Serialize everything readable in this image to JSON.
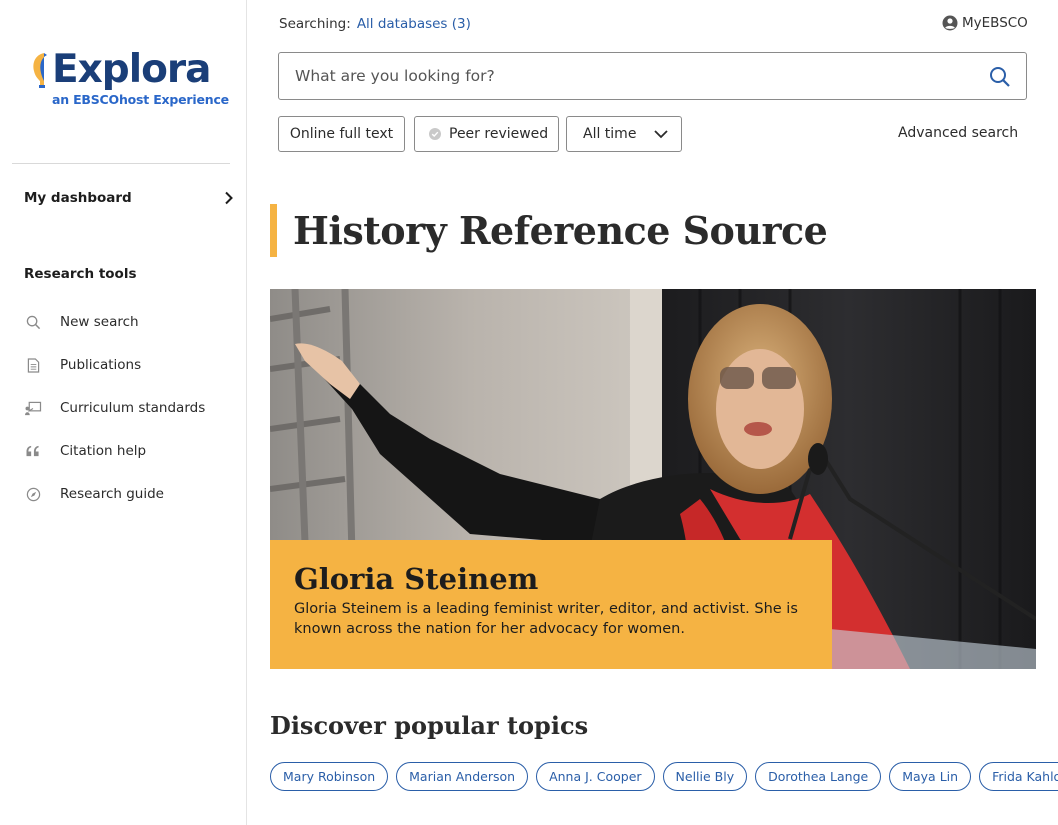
{
  "brand": {
    "name": "Explora",
    "tagline": "an EBSCOhost Experience",
    "colors": {
      "navy": "#1a3e78",
      "blue": "#2a67c9",
      "accent": "#f5b343",
      "link": "#2a5ea8"
    }
  },
  "sidebar": {
    "dashboard_label": "My dashboard",
    "tools_title": "Research tools",
    "tools": [
      {
        "label": "New search",
        "icon": "search-icon"
      },
      {
        "label": "Publications",
        "icon": "document-icon"
      },
      {
        "label": "Curriculum standards",
        "icon": "presentation-icon"
      },
      {
        "label": "Citation help",
        "icon": "quote-icon"
      },
      {
        "label": "Research guide",
        "icon": "compass-icon"
      }
    ]
  },
  "header": {
    "searching_label": "Searching:",
    "databases_link": "All databases (3)",
    "account_label": "MyEBSCO"
  },
  "search": {
    "placeholder": "What are you looking for?",
    "value": ""
  },
  "filters": {
    "full_text": "Online full text",
    "peer_reviewed": "Peer reviewed",
    "time": "All time",
    "advanced": "Advanced search"
  },
  "main": {
    "title": "History Reference Source",
    "feature": {
      "name": "Gloria Steinem",
      "description": "Gloria Steinem is a leading feminist writer, editor, and activist. She is known across the nation for her advocacy for women."
    },
    "topics_title": "Discover popular topics",
    "topics": [
      "Mary Robinson",
      "Marian Anderson",
      "Anna J. Cooper",
      "Nellie Bly",
      "Dorothea Lange",
      "Maya Lin",
      "Frida Kahlo"
    ]
  }
}
